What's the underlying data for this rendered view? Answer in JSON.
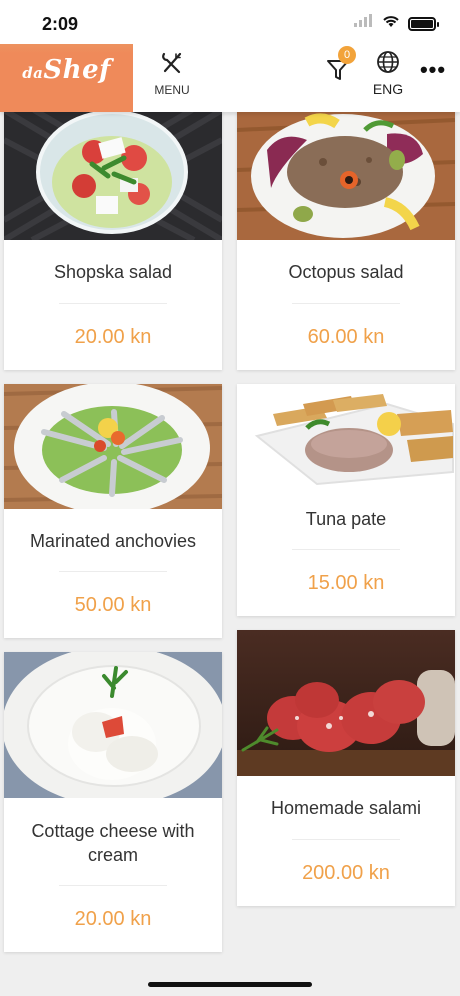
{
  "status_bar": {
    "time": "2:09"
  },
  "header": {
    "logo_prefix": "da",
    "logo_main": "Shef",
    "menu_label": "MENU",
    "filter_badge": "0",
    "language_label": "ENG",
    "more_label": "•••"
  },
  "products": [
    {
      "name": "Shopska salad",
      "price": "20.00 kn"
    },
    {
      "name": "Octopus salad",
      "price": "60.00 kn"
    },
    {
      "name": "Marinated anchovies",
      "price": "50.00 kn"
    },
    {
      "name": "Tuna pate",
      "price": "15.00 kn"
    },
    {
      "name": "Cottage cheese with cream",
      "price": "20.00 kn"
    },
    {
      "name": "Homemade salami",
      "price": "200.00 kn"
    }
  ],
  "colors": {
    "accent": "#ef8a5a",
    "price": "#f0a14a",
    "badge": "#f2a33a"
  }
}
